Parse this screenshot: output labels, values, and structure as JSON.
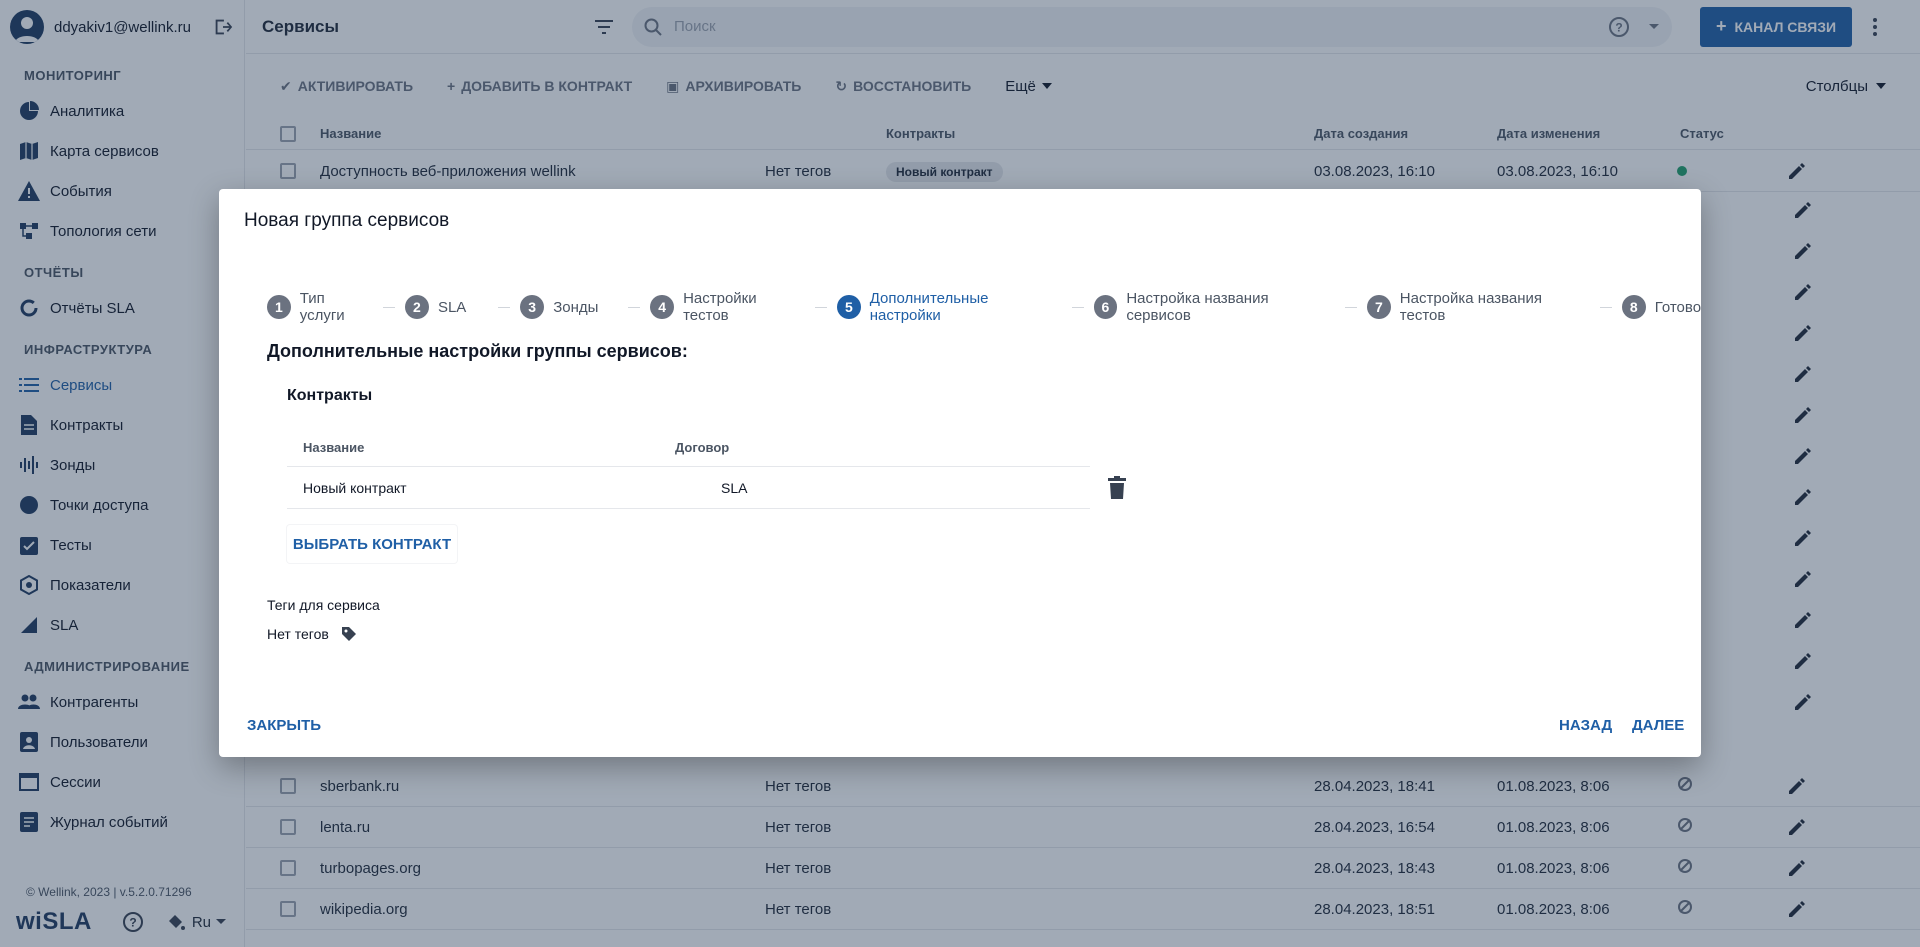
{
  "user": {
    "email": "ddyakiv1@wellink.ru"
  },
  "sidebar": {
    "sections": [
      {
        "title": "МОНИТОРИНГ",
        "items": [
          "Аналитика",
          "Карта сервисов",
          "События",
          "Топология сети"
        ]
      },
      {
        "title": "ОТЧЁТЫ",
        "items": [
          "Отчёты SLA"
        ]
      },
      {
        "title": "ИНФРАСТРУКТУРА",
        "items": [
          "Сервисы",
          "Контракты",
          "Зонды",
          "Точки доступа",
          "Тесты",
          "Показатели",
          "SLA"
        ]
      },
      {
        "title": "АДМИНИСТРИРОВАНИЕ",
        "items": [
          "Контрагенты",
          "Пользователи",
          "Сессии",
          "Журнал событий"
        ]
      }
    ],
    "footer": "© Wellink, 2023 | v.5.2.0.71296",
    "logo": "wiSLA",
    "lang": "Ru"
  },
  "header": {
    "title": "Сервисы",
    "search_placeholder": "Поиск",
    "cta": "КАНАЛ СВЯЗИ"
  },
  "toolbar": {
    "activate": "АКТИВИРОВАТЬ",
    "add_to_contract": "ДОБАВИТЬ В КОНТРАКТ",
    "archive": "АРХИВИРОВАТЬ",
    "restore": "ВОССТАНОВИТЬ",
    "more": "Ещё",
    "columns": "Столбцы"
  },
  "table": {
    "headers": {
      "name": "Название",
      "contracts": "Контракты",
      "created": "Дата создания",
      "modified": "Дата изменения",
      "status": "Статус"
    },
    "top_rows": [
      {
        "name": "Доступность веб-приложения wellink",
        "tags": "Нет тегов",
        "contract": "Новый контракт",
        "created": "03.08.2023, 16:10",
        "modified": "03.08.2023, 16:10"
      }
    ],
    "bottom_rows": [
      {
        "name": "sberbank.ru",
        "tags": "Нет тегов",
        "created": "28.04.2023, 18:41",
        "modified": "01.08.2023, 8:06"
      },
      {
        "name": "lenta.ru",
        "tags": "Нет тегов",
        "created": "28.04.2023, 16:54",
        "modified": "01.08.2023, 8:06"
      },
      {
        "name": "turbopages.org",
        "tags": "Нет тегов",
        "created": "28.04.2023, 18:43",
        "modified": "01.08.2023, 8:06"
      },
      {
        "name": "wikipedia.org",
        "tags": "Нет тегов",
        "created": "28.04.2023, 18:51",
        "modified": "01.08.2023, 8:06"
      }
    ]
  },
  "modal": {
    "title": "Новая группа сервисов",
    "steps": [
      {
        "num": "1",
        "label": "Тип услуги"
      },
      {
        "num": "2",
        "label": "SLA"
      },
      {
        "num": "3",
        "label": "Зонды"
      },
      {
        "num": "4",
        "label": "Настройки тестов"
      },
      {
        "num": "5",
        "label": "Дополнительные настройки"
      },
      {
        "num": "6",
        "label": "Настройка названия сервисов"
      },
      {
        "num": "7",
        "label": "Настройка названия тестов"
      },
      {
        "num": "8",
        "label": "Готово"
      }
    ],
    "active_step": 5,
    "subtitle": "Дополнительные настройки группы сервисов:",
    "contracts_title": "Контракты",
    "contracts_headers": {
      "name": "Название",
      "agreement": "Договор"
    },
    "contract_row": {
      "name": "Новый контракт",
      "agreement": "SLA"
    },
    "choose_contract": "ВЫБРАТЬ КОНТРАКТ",
    "tags_label": "Теги для сервиса",
    "tags_value": "Нет тегов",
    "close": "ЗАКРЫТЬ",
    "back": "НАЗАД",
    "next": "ДАЛЕЕ"
  },
  "colors": {
    "accent": "#1f5fa6",
    "status_ok": "#22a06b"
  }
}
